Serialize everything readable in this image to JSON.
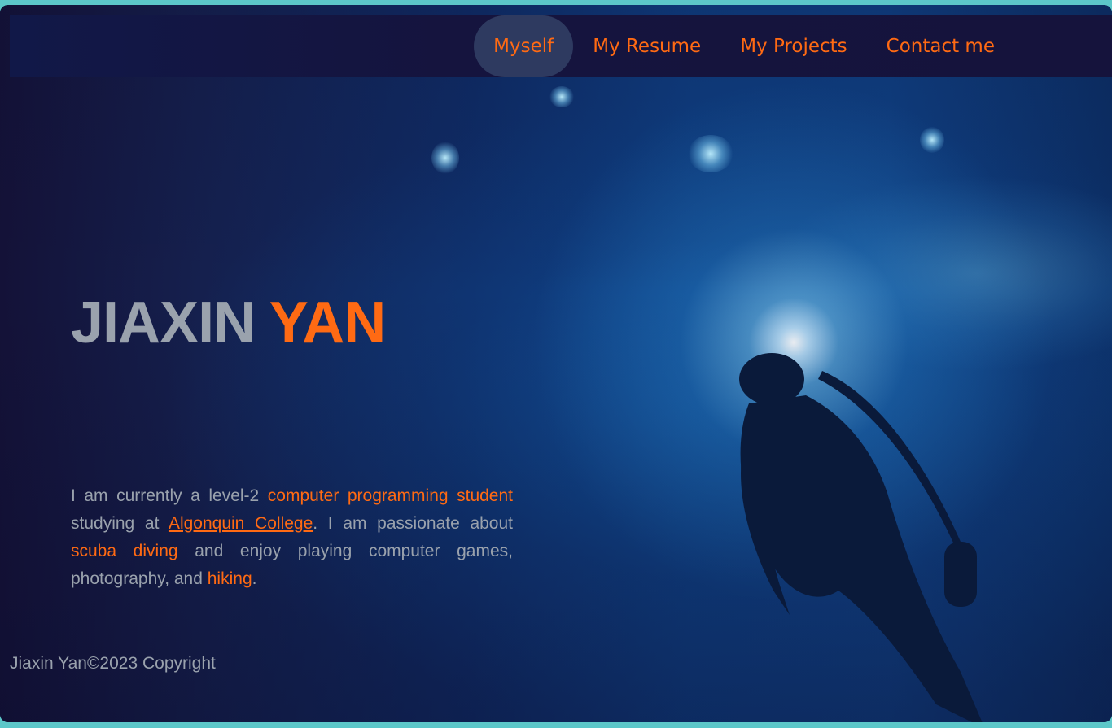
{
  "nav": {
    "items": [
      {
        "label": "Myself",
        "active": true
      },
      {
        "label": "My Resume",
        "active": false
      },
      {
        "label": "My Projects",
        "active": false
      },
      {
        "label": "Contact me",
        "active": false
      }
    ]
  },
  "hero": {
    "first_name": "JIAXIN",
    "last_name": "YAN"
  },
  "intro": {
    "part1": "I am currently a level-2 ",
    "highlight1": "computer programming student",
    "part2": " studying at ",
    "link_college": "Algonquin College",
    "part3": ". I am passionate about ",
    "highlight2": "scuba diving",
    "part4": " and enjoy playing computer games, photography, and ",
    "highlight3": "hiking",
    "part5": "."
  },
  "footer": {
    "copyright": "Jiaxin Yan©2023 Copyright"
  },
  "colors": {
    "accent": "#ff6a13",
    "text_muted": "#9aa2ad",
    "nav_bg": "#141541",
    "nav_active_bg": "#2e3a60",
    "page_border": "#5cc7c9"
  }
}
